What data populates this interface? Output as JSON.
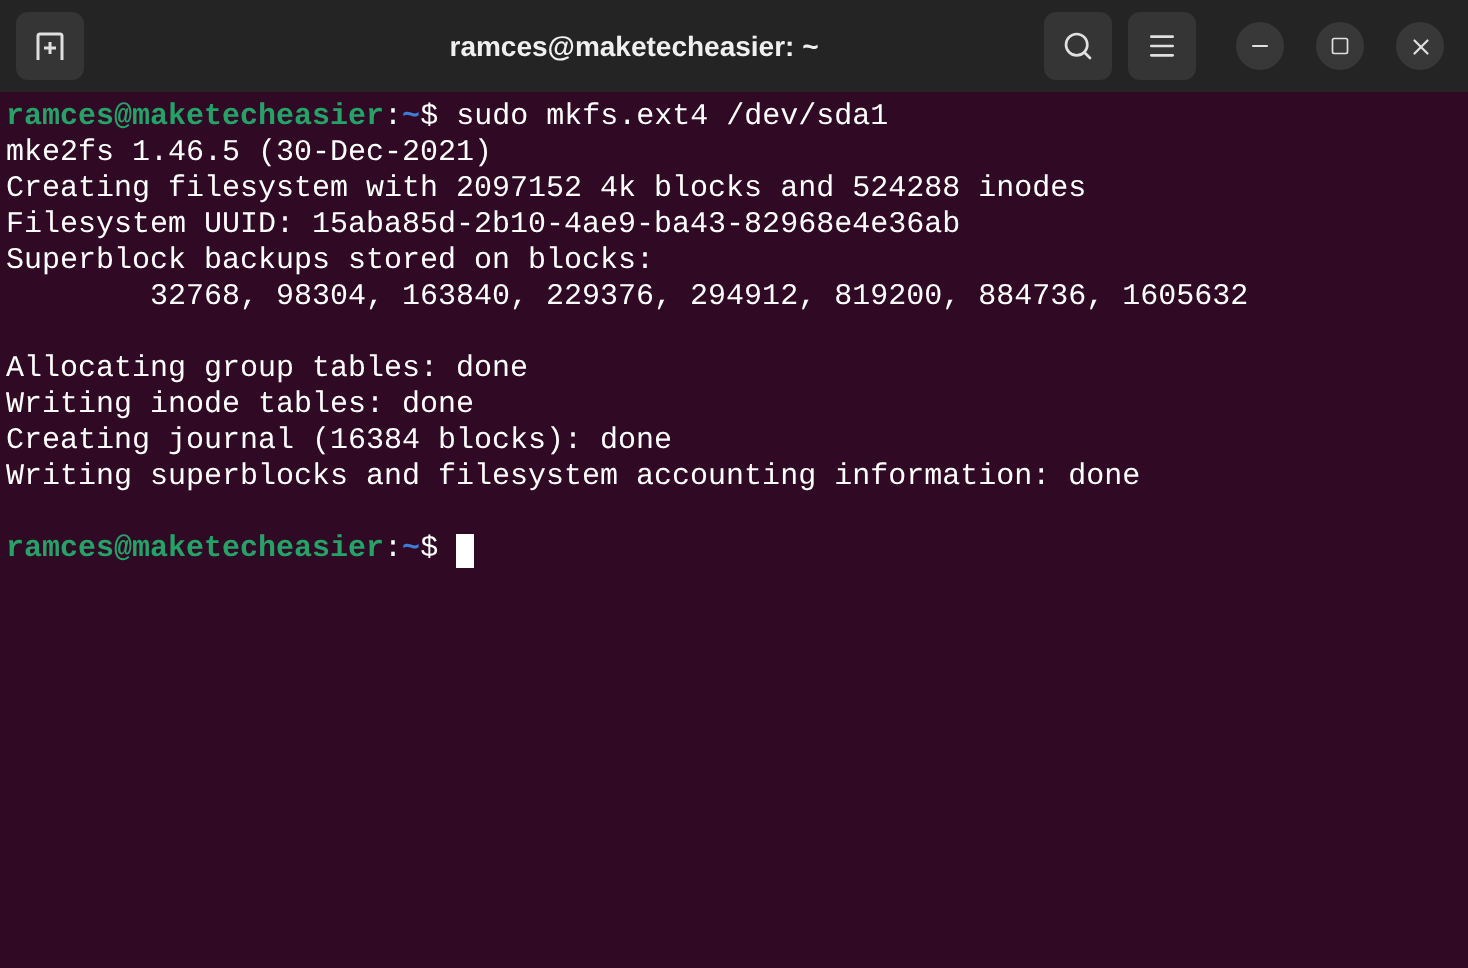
{
  "window": {
    "title": "ramces@maketecheasier: ~"
  },
  "terminal": {
    "lines": [
      {
        "kind": "prompt",
        "user_host": "ramces@maketecheasier",
        "separator": ":",
        "path": "~",
        "symbol": "$",
        "command": "sudo mkfs.ext4 /dev/sda1",
        "cursor": false
      },
      {
        "kind": "output",
        "text": "mke2fs 1.46.5 (30-Dec-2021)"
      },
      {
        "kind": "output",
        "text": "Creating filesystem with 2097152 4k blocks and 524288 inodes"
      },
      {
        "kind": "output",
        "text": "Filesystem UUID: 15aba85d-2b10-4ae9-ba43-82968e4e36ab"
      },
      {
        "kind": "output",
        "text": "Superblock backups stored on blocks:"
      },
      {
        "kind": "output",
        "text": "        32768, 98304, 163840, 229376, 294912, 819200, 884736, 1605632"
      },
      {
        "kind": "blank"
      },
      {
        "kind": "output",
        "text": "Allocating group tables: done"
      },
      {
        "kind": "output",
        "text": "Writing inode tables: done"
      },
      {
        "kind": "output",
        "text": "Creating journal (16384 blocks): done"
      },
      {
        "kind": "output",
        "text": "Writing superblocks and filesystem accounting information: done"
      },
      {
        "kind": "blank"
      },
      {
        "kind": "prompt",
        "user_host": "ramces@maketecheasier",
        "separator": ":",
        "path": "~",
        "symbol": "$",
        "cursor": true
      }
    ]
  }
}
